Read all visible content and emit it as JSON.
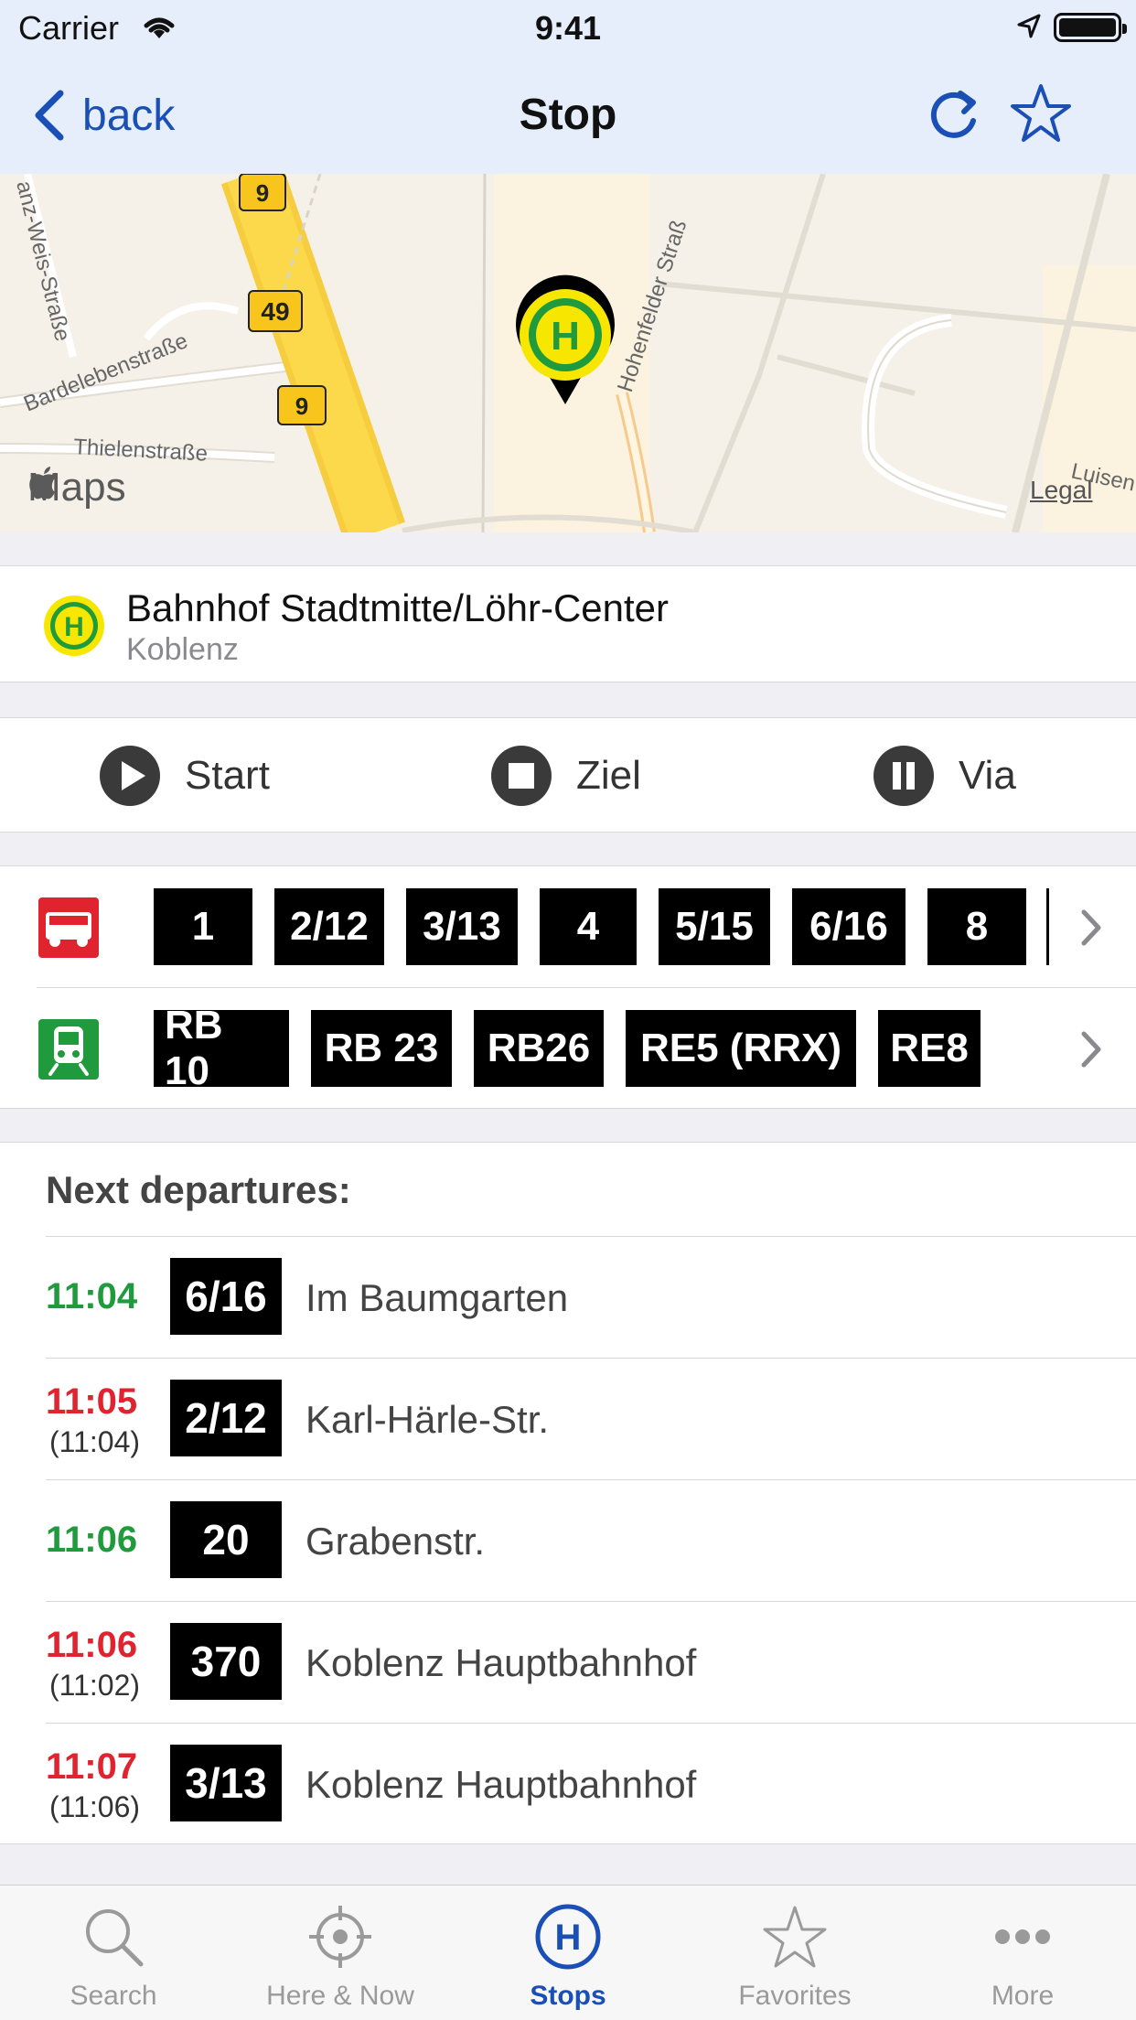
{
  "status_bar": {
    "carrier": "Carrier",
    "time": "9:41"
  },
  "nav": {
    "back_label": "back",
    "title": "Stop"
  },
  "map": {
    "logo_text": "Maps",
    "legal": "Legal",
    "streets": [
      "anz-Weis-Straße",
      "Bardelebenstraße",
      "Thielenstraße",
      "Hohenfelder Straß",
      "Luisen"
    ],
    "road_shields": [
      "9",
      "49",
      "9"
    ]
  },
  "stop": {
    "name": "Bahnhof Stadtmitte/Löhr-Center",
    "city": "Koblenz"
  },
  "route_actions": {
    "start": "Start",
    "destination": "Ziel",
    "via": "Via"
  },
  "lines": {
    "bus": [
      "1",
      "2/12",
      "3/13",
      "4",
      "5/15",
      "6/16",
      "8"
    ],
    "train": [
      "RB 10",
      "RB 23",
      "RB26",
      "RE5 (RRX)",
      "RE8"
    ]
  },
  "departures": {
    "title": "Next departures:",
    "items": [
      {
        "time": "11:04",
        "scheduled": "",
        "status": "on-time",
        "line": "6/16",
        "destination": "Im Baumgarten"
      },
      {
        "time": "11:05",
        "scheduled": "(11:04)",
        "status": "late",
        "line": "2/12",
        "destination": "Karl-Härle-Str."
      },
      {
        "time": "11:06",
        "scheduled": "",
        "status": "on-time",
        "line": "20",
        "destination": "Grabenstr."
      },
      {
        "time": "11:06",
        "scheduled": "(11:02)",
        "status": "late",
        "line": "370",
        "destination": "Koblenz Hauptbahnhof"
      },
      {
        "time": "11:07",
        "scheduled": "(11:06)",
        "status": "late",
        "line": "3/13",
        "destination": "Koblenz Hauptbahnhof"
      }
    ]
  },
  "tabs": [
    {
      "label": "Search",
      "icon": "search-icon",
      "active": false
    },
    {
      "label": "Here & Now",
      "icon": "crosshair-icon",
      "active": false
    },
    {
      "label": "Stops",
      "icon": "stop-h-icon",
      "active": true
    },
    {
      "label": "Favorites",
      "icon": "star-icon",
      "active": false
    },
    {
      "label": "More",
      "icon": "more-icon",
      "active": false
    }
  ],
  "colors": {
    "accent": "#1a4fb5",
    "on_time": "#1f9a3c",
    "late": "#e0232e",
    "bus_mode": "#e0232e",
    "train_mode": "#1f9a3c",
    "stop_badge_yellow": "#f7e600"
  }
}
